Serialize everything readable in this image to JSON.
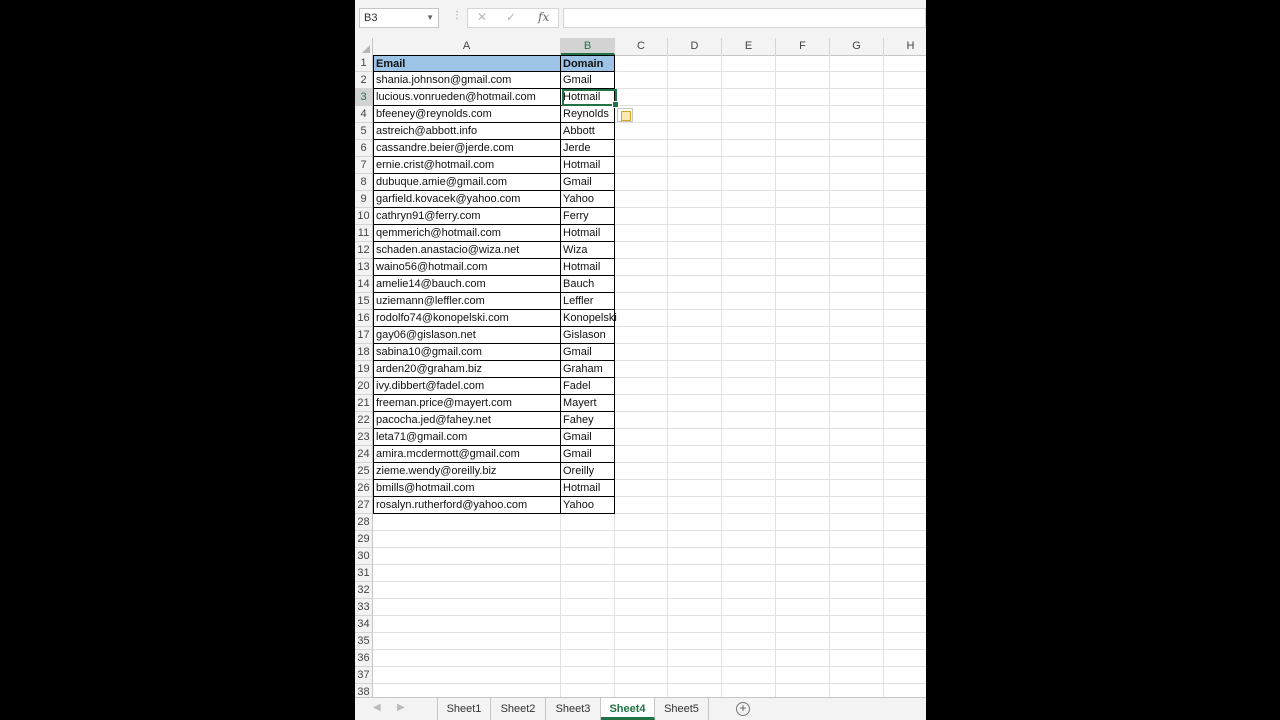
{
  "formula_bar": {
    "name_box": "B3",
    "cancel_icon": "✕",
    "enter_icon": "✓",
    "fx_label": "fx",
    "formula": ""
  },
  "columns": [
    "A",
    "B",
    "C",
    "D",
    "E",
    "F",
    "G",
    "H"
  ],
  "header_row": {
    "email": "Email",
    "domain": "Domain"
  },
  "records": [
    [
      "shania.johnson@gmail.com",
      "Gmail"
    ],
    [
      "lucious.vonrueden@hotmail.com",
      "Hotmail"
    ],
    [
      "bfeeney@reynolds.com",
      "Reynolds"
    ],
    [
      "astreich@abbott.info",
      "Abbott"
    ],
    [
      "cassandre.beier@jerde.com",
      "Jerde"
    ],
    [
      "ernie.crist@hotmail.com",
      "Hotmail"
    ],
    [
      "dubuque.amie@gmail.com",
      "Gmail"
    ],
    [
      "garfield.kovacek@yahoo.com",
      "Yahoo"
    ],
    [
      "cathryn91@ferry.com",
      "Ferry"
    ],
    [
      "qemmerich@hotmail.com",
      "Hotmail"
    ],
    [
      "schaden.anastacio@wiza.net",
      "Wiza"
    ],
    [
      "waino56@hotmail.com",
      "Hotmail"
    ],
    [
      "amelie14@bauch.com",
      "Bauch"
    ],
    [
      "uziemann@leffler.com",
      "Leffler"
    ],
    [
      "rodolfo74@konopelski.com",
      "Konopelski"
    ],
    [
      "gay06@gislason.net",
      "Gislason"
    ],
    [
      "sabina10@gmail.com",
      "Gmail"
    ],
    [
      "arden20@graham.biz",
      "Graham"
    ],
    [
      "ivy.dibbert@fadel.com",
      "Fadel"
    ],
    [
      "freeman.price@mayert.com",
      "Mayert"
    ],
    [
      "pacocha.jed@fahey.net",
      "Fahey"
    ],
    [
      "leta71@gmail.com",
      "Gmail"
    ],
    [
      "amira.mcdermott@gmail.com",
      "Gmail"
    ],
    [
      "zieme.wendy@oreilly.biz",
      "Oreilly"
    ],
    [
      "bmills@hotmail.com",
      "Hotmail"
    ],
    [
      "rosalyn.rutherford@yahoo.com",
      "Yahoo"
    ]
  ],
  "row_numbers": [
    "1",
    "2",
    "3",
    "4",
    "5",
    "6",
    "7",
    "8",
    "9",
    "10",
    "11",
    "12",
    "13",
    "14",
    "15",
    "16",
    "17",
    "18",
    "19",
    "20",
    "21",
    "22",
    "23",
    "24",
    "25",
    "26",
    "27",
    "28",
    "29",
    "30",
    "31",
    "32",
    "33",
    "34",
    "35",
    "36",
    "37",
    "38"
  ],
  "selected_cell": {
    "column": "B",
    "row": "3"
  },
  "sheets": [
    "Sheet1",
    "Sheet2",
    "Sheet3",
    "Sheet4",
    "Sheet5"
  ],
  "active_sheet": "Sheet4",
  "add_sheet_icon": "+",
  "colors": {
    "accent": "#217346",
    "header_fill": "#9dc3e6"
  }
}
